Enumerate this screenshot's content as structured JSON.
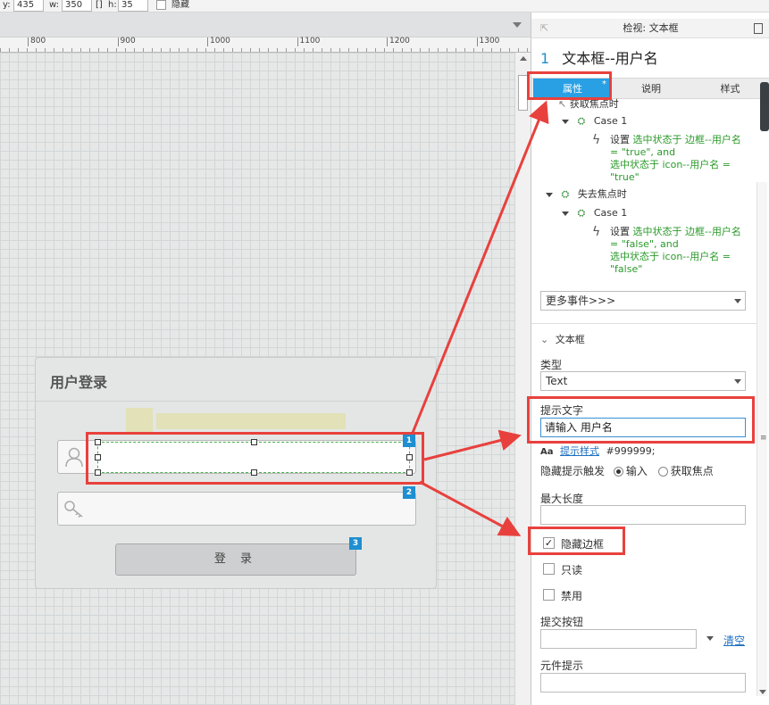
{
  "toolbar": {
    "y_label": "y:",
    "y_value": "435",
    "w_label": "w:",
    "w_value": "350",
    "h_label": "h:",
    "h_value": "35",
    "hide_label": "隐藏"
  },
  "ruler": {
    "ticks": [
      "800",
      "900",
      "1000",
      "1100",
      "1200",
      "1300"
    ]
  },
  "login_card": {
    "title": "用户登录",
    "login_button": "登 录",
    "badges": [
      "1",
      "2",
      "3"
    ]
  },
  "panel": {
    "header": "检视: 文本框",
    "widget_number": "1",
    "widget_name": "文本框--用户名",
    "tabs": [
      {
        "label": "属性",
        "marker": "*"
      },
      {
        "label": "说明"
      },
      {
        "label": "样式"
      }
    ],
    "events": [
      {
        "name": "获取焦点时",
        "case": "Case 1",
        "set_label": "设置",
        "line1": "选中状态于 边框--用户名",
        "line2": "= \"true\", and",
        "line3": "选中状态于 icon--用户名 =",
        "line4": "\"true\""
      },
      {
        "name": "失去焦点时",
        "case": "Case 1",
        "set_label": "设置",
        "line1": "选中状态于 边框--用户名",
        "line2": "= \"false\", and",
        "line3": "选中状态于 icon--用户名 =",
        "line4": "\"false\""
      }
    ],
    "more_events": "更多事件>>>",
    "section_title": "文本框",
    "type_label": "类型",
    "type_value": "Text",
    "hint_label": "提示文字",
    "hint_value": "请输入 用户名",
    "hint_style_aa": "Aa",
    "hint_style_link": "提示样式",
    "hint_style_color": "#999999;",
    "hide_hint_label": "隐藏提示触发",
    "hide_hint_option1": "输入",
    "hide_hint_option2": "获取焦点",
    "maxlen_label": "最大长度",
    "maxlen_value": "",
    "hide_border_label": "隐藏边框",
    "hide_border_checked": true,
    "readonly_label": "只读",
    "disabled_label": "禁用",
    "submit_label": "提交按钮",
    "submit_value": "",
    "clear_link": "清空",
    "tooltip_label": "元件提示",
    "tooltip_value": ""
  },
  "colors": {
    "accent": "#29a0e4",
    "callout": "#e8413d",
    "action_text": "#2a9a2a",
    "badge": "#1e8fd0"
  }
}
